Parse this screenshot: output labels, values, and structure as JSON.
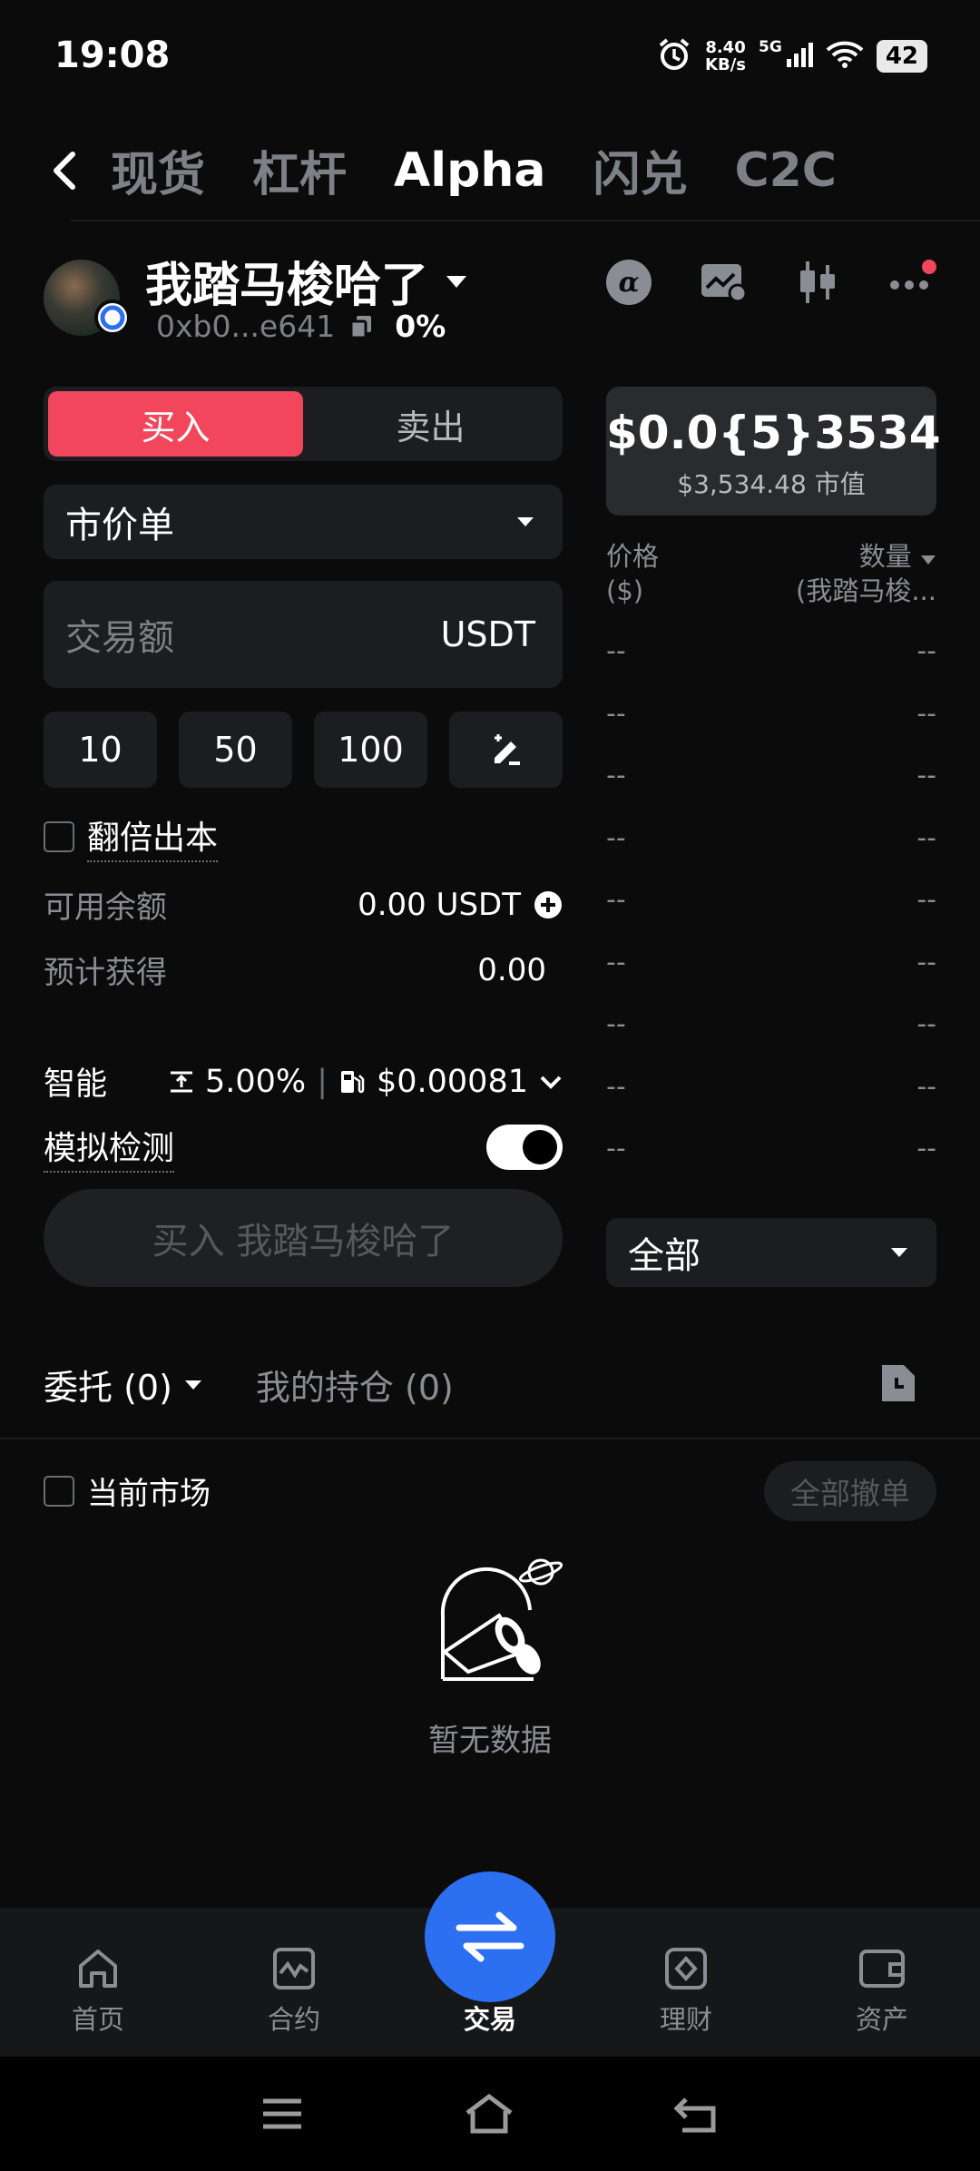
{
  "status": {
    "time": "19:08",
    "net_speed_value": "8.40",
    "net_speed_unit": "KB/s",
    "network": "5G",
    "battery": "42"
  },
  "nav": {
    "tabs": [
      "现货",
      "杠杆",
      "Alpha",
      "闪兑",
      "C2C"
    ],
    "active": "Alpha"
  },
  "token": {
    "name": "我踏马梭哈了",
    "address": "0xb0...e641",
    "change": "0%"
  },
  "trade": {
    "buy_label": "买入",
    "sell_label": "卖出",
    "order_type": "市价单",
    "amount_placeholder": "交易额",
    "amount_currency": "USDT",
    "quick_amounts": [
      "10",
      "50",
      "100"
    ],
    "double_label": "翻倍出本",
    "available_label": "可用余额",
    "available_value": "0.00 USDT",
    "expected_label": "预计获得",
    "expected_value": "0.00",
    "smart_label": "智能",
    "slippage": "5.00%",
    "gas": "$0.00081",
    "sim_label": "模拟检测",
    "buy_button": "买入 我踏马梭哈了"
  },
  "market": {
    "price": "$0.0{5}3534",
    "market_cap_value": "$3,534.48",
    "market_cap_label": "市值",
    "col_price_line1": "价格",
    "col_price_line2": "($)",
    "col_qty_line1": "数量",
    "col_qty_line2": "(我踏马梭...",
    "rows": [
      [
        "--",
        "--"
      ],
      [
        "--",
        "--"
      ],
      [
        "--",
        "--"
      ],
      [
        "--",
        "--"
      ],
      [
        "--",
        "--"
      ],
      [
        "--",
        "--"
      ],
      [
        "--",
        "--"
      ],
      [
        "--",
        "--"
      ],
      [
        "--",
        "--"
      ]
    ],
    "filter": "全部"
  },
  "orders": {
    "tab_orders": "委托 (0)",
    "tab_positions": "我的持仓 (0)",
    "current_market": "当前市场",
    "cancel_all": "全部撤单",
    "empty": "暂无数据"
  },
  "bottom_nav": {
    "home": "首页",
    "futures": "合约",
    "trade": "交易",
    "earn": "理财",
    "assets": "资产"
  },
  "colors": {
    "buy": "#f2465c",
    "primary": "#2d6ff1",
    "bg": "#0b0b0c",
    "surface": "#1c1d20"
  }
}
